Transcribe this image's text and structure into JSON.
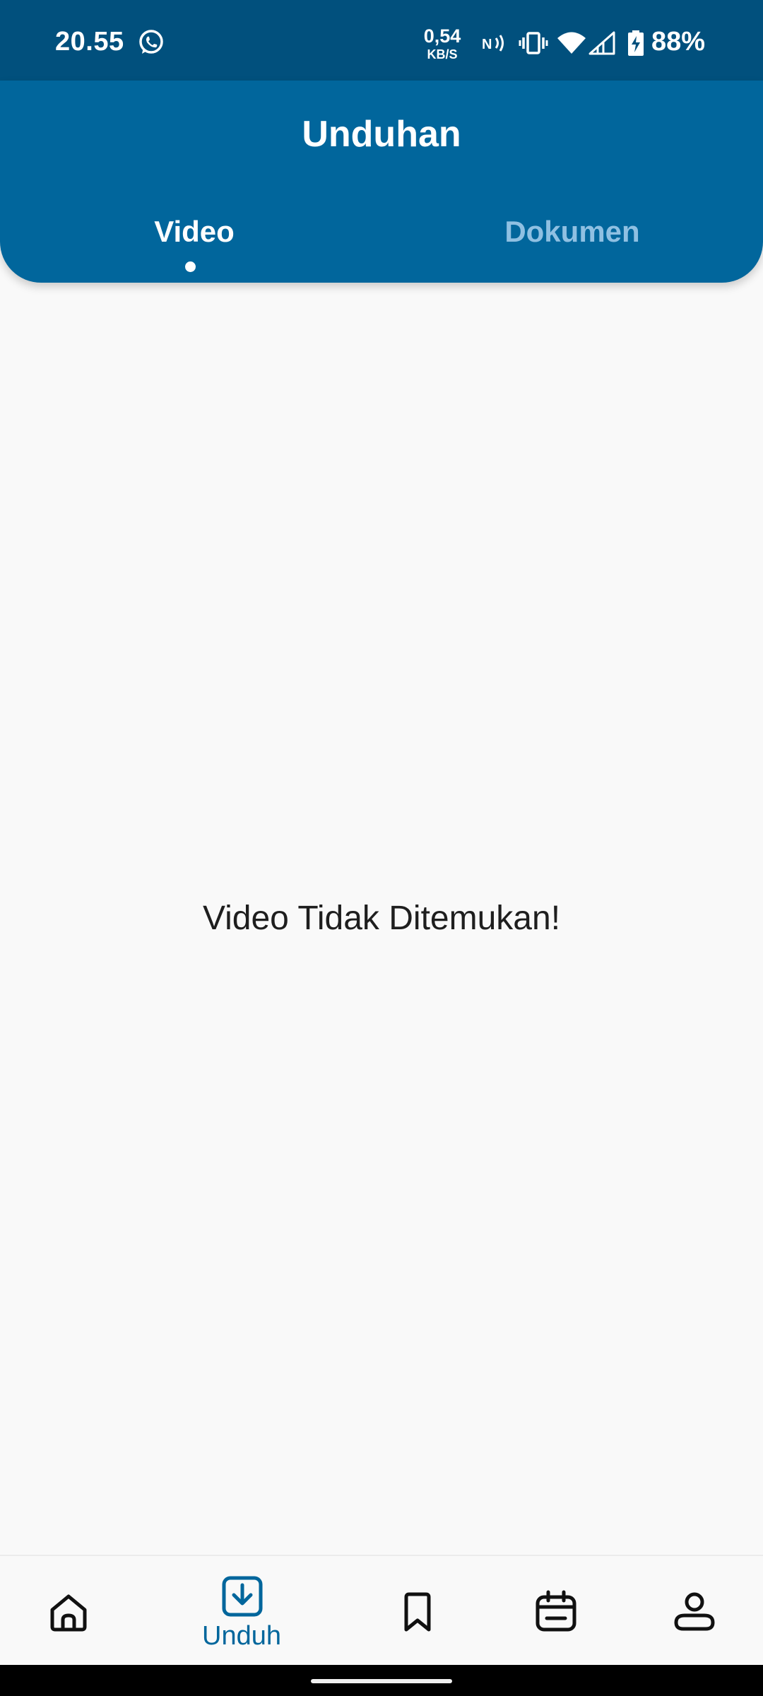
{
  "status_bar": {
    "time": "20.55",
    "net_speed_value": "0,54",
    "net_speed_unit": "KB/S",
    "battery": "88%",
    "icons": [
      "whatsapp-icon",
      "nfc-icon",
      "vibrate-icon",
      "wifi-icon",
      "cellular-signal-icon",
      "battery-charging-icon"
    ]
  },
  "header": {
    "title": "Unduhan",
    "tabs": [
      {
        "label": "Video",
        "active": true
      },
      {
        "label": "Dokumen",
        "active": false
      }
    ]
  },
  "main": {
    "empty_message": "Video Tidak Ditemukan!"
  },
  "bottom_nav": {
    "items": [
      {
        "icon": "home-icon",
        "label": "",
        "active": false
      },
      {
        "icon": "download-icon",
        "label": "Unduh",
        "active": true
      },
      {
        "icon": "bookmark-icon",
        "label": "",
        "active": false
      },
      {
        "icon": "calendar-icon",
        "label": "",
        "active": false
      },
      {
        "icon": "profile-icon",
        "label": "",
        "active": false
      }
    ]
  },
  "colors": {
    "status_bar": "#01507d",
    "header": "#01669c",
    "inactive_tab": "#8fc0e2",
    "accent": "#01669c",
    "background": "#f9f9f9"
  }
}
